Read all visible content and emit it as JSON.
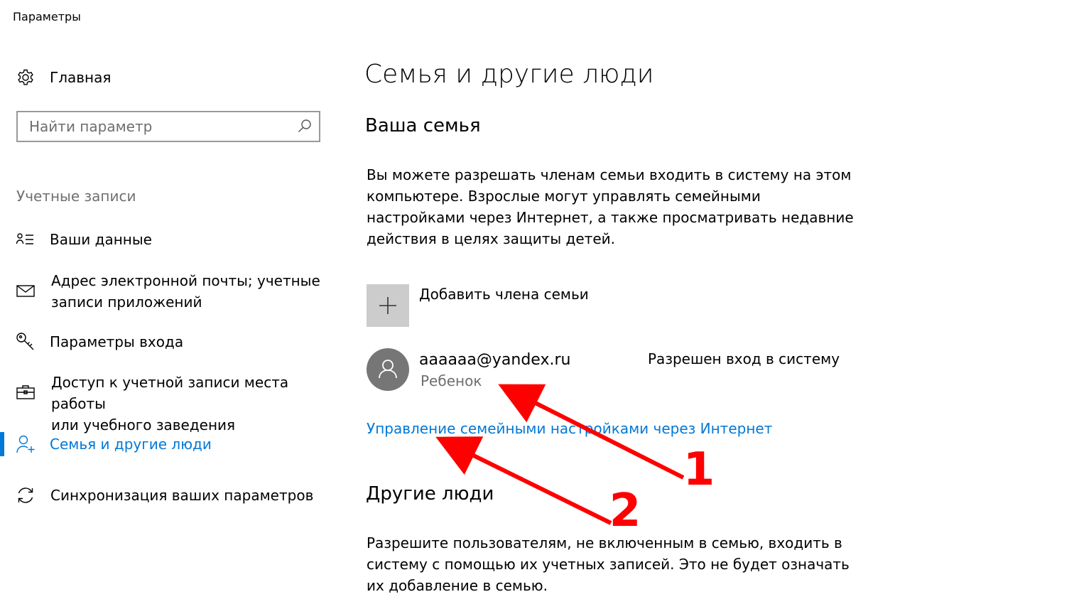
{
  "window": {
    "title": "Параметры"
  },
  "sidebar": {
    "home_label": "Главная",
    "search_placeholder": "Найти параметр",
    "search_value": "",
    "section_label": "Учетные записи",
    "items": [
      {
        "label": "Ваши данные",
        "icon": "contact-card-icon",
        "active": false
      },
      {
        "label": "Адрес электронной почты; учетные\nзаписи приложений",
        "icon": "mail-icon",
        "active": false
      },
      {
        "label": "Параметры входа",
        "icon": "key-icon",
        "active": false
      },
      {
        "label": "Доступ к учетной записи места работы\nили учебного заведения",
        "icon": "briefcase-icon",
        "active": false
      },
      {
        "label": "Семья и другие люди",
        "icon": "add-person-icon",
        "active": true
      },
      {
        "label": "Синхронизация ваших параметров",
        "icon": "sync-icon",
        "active": false
      }
    ]
  },
  "main": {
    "title": "Семья и другие люди",
    "family": {
      "heading": "Ваша семья",
      "description": "Вы можете разрешать членам семьи входить в систему на этом\nкомпьютере. Взрослые могут управлять семейными\nнастройками через Интернет, а также просматривать недавние\nдействия в целях защиты детей.",
      "add_label": "Добавить члена семьи",
      "account": {
        "email": "aaaaaa@yandex.ru",
        "role": "Ребенок",
        "status": "Разрешен вход в систему"
      },
      "manage_link": "Управление семейными настройками через Интернет"
    },
    "others": {
      "heading": "Другие люди",
      "description": "Разрешите пользователям, не включенным в семью, входить в\nсистему с помощью их учетных записей. Это не будет означать\nих добавление в семью."
    }
  },
  "annotations": {
    "marker_1": "1",
    "marker_2": "2",
    "color": "#ff0000"
  },
  "colors": {
    "accent": "#0078d7",
    "tile": "#cccccc",
    "avatar": "#767676"
  }
}
